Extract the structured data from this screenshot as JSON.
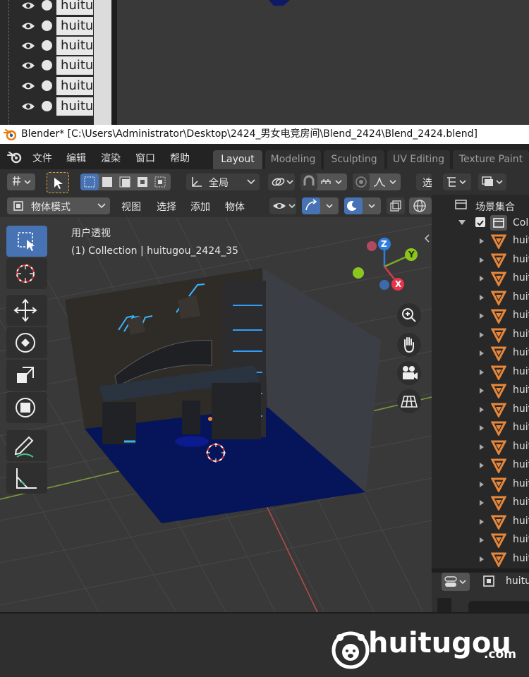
{
  "top_outliner": {
    "rows": [
      "huitu",
      "huitu",
      "huitu",
      "huitu",
      "huitu",
      "huitu"
    ]
  },
  "window": {
    "title": "Blender* [C:\\Users\\Administrator\\Desktop\\2424_男女电竞房间\\Blend_2424\\Blend_2424.blend]"
  },
  "menu": {
    "items": [
      "文件",
      "编辑",
      "渲染",
      "窗口",
      "帮助"
    ]
  },
  "workspaces": {
    "tabs": [
      "Layout",
      "Modeling",
      "Sculpting",
      "UV Editing",
      "Texture Paint"
    ],
    "active": "Layout"
  },
  "header": {
    "transform_orientation": "全局",
    "overflow_label": "选",
    "mode": "物体模式",
    "view_menu": "视图",
    "select_menu": "选择",
    "add_menu": "添加",
    "object_menu": "物体"
  },
  "viewport": {
    "view_name": "用户透视",
    "collection_info": "(1) Collection | huitugou_2424_35",
    "gizmo_axes": {
      "z": "Z",
      "y": "Y",
      "x": "X"
    }
  },
  "outliner": {
    "scene_collection": "场景集合",
    "collection": "Coll",
    "items": [
      "huit",
      "huit",
      "huit",
      "huit",
      "huit",
      "huit",
      "huit",
      "huit",
      "huit",
      "huit",
      "huit",
      "huit",
      "huit",
      "huit",
      "huit",
      "huit",
      "huit",
      "huit"
    ]
  },
  "properties": {
    "name": "huitu"
  },
  "brand": {
    "name": "huitugou",
    "suffix": ".com"
  },
  "colors": {
    "accent": "#4772b3",
    "floor": "#06155a",
    "mesh_orange": "#e8873a"
  }
}
